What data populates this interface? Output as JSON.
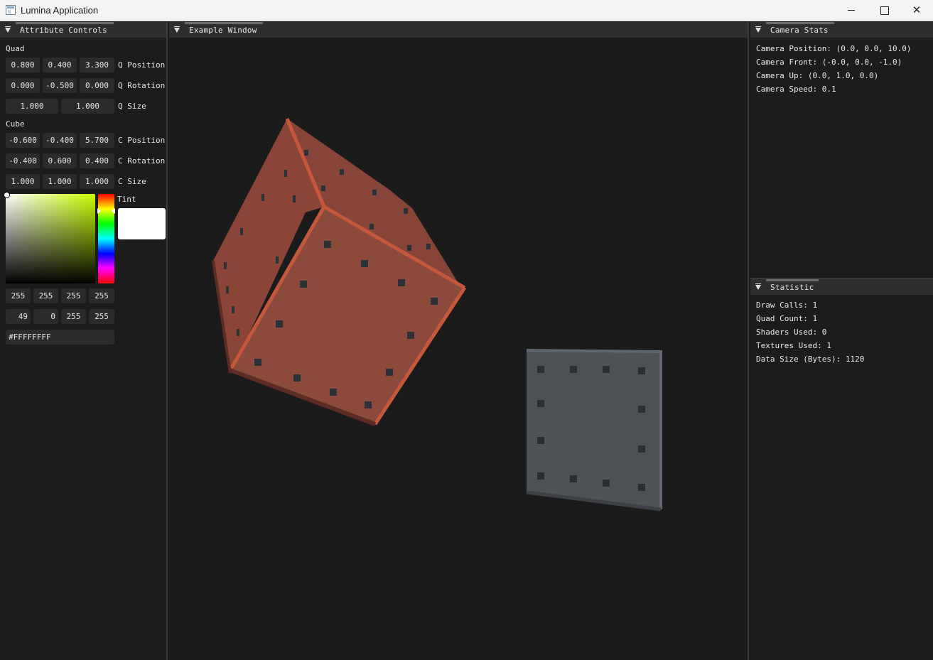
{
  "window": {
    "title": "Lumina Application"
  },
  "panels": {
    "attributes": {
      "title": "Attribute Controls",
      "quad_label": "Quad",
      "cube_label": "Cube",
      "q_position": {
        "label": "Q Position",
        "values": [
          "0.800",
          "0.400",
          "3.300"
        ]
      },
      "q_rotation": {
        "label": "Q Rotation",
        "values": [
          "0.000",
          "-0.500",
          "0.000"
        ]
      },
      "q_size": {
        "label": "Q Size",
        "values": [
          "1.000",
          "1.000"
        ]
      },
      "c_position": {
        "label": "C Position",
        "values": [
          "-0.600",
          "-0.400",
          "5.700"
        ]
      },
      "c_rotation": {
        "label": "C Rotation",
        "values": [
          "-0.400",
          "0.600",
          "0.400"
        ]
      },
      "c_size": {
        "label": "C Size",
        "values": [
          "1.000",
          "1.000",
          "1.000"
        ]
      },
      "tint": {
        "label": "Tint",
        "swatch_color": "#FFFFFF",
        "rgba": [
          "255",
          "255",
          "255",
          "255"
        ],
        "hsva": [
          "49",
          "0",
          "255",
          "255"
        ],
        "hex": "#FFFFFFFF"
      }
    },
    "example": {
      "title": "Example Window"
    },
    "camera": {
      "title": "Camera Stats",
      "lines": [
        "Camera Position: (0.0, 0.0, 10.0)",
        "Camera Front: (-0.0, 0.0, -1.0)",
        "Camera Up: (0.0, 1.0, 0.0)",
        "Camera Speed: 0.1"
      ]
    },
    "statistic": {
      "title": "Statistic",
      "lines": [
        "Draw Calls: 1",
        "Quad Count: 1",
        "Shaders Used: 0",
        "Textures Used: 1",
        "Data Size (Bytes): 1120"
      ]
    }
  },
  "scene": {
    "cube_color": "#8b4a3c",
    "cube_edge_color": "#c4573c",
    "quad_color": "#4e5257"
  }
}
